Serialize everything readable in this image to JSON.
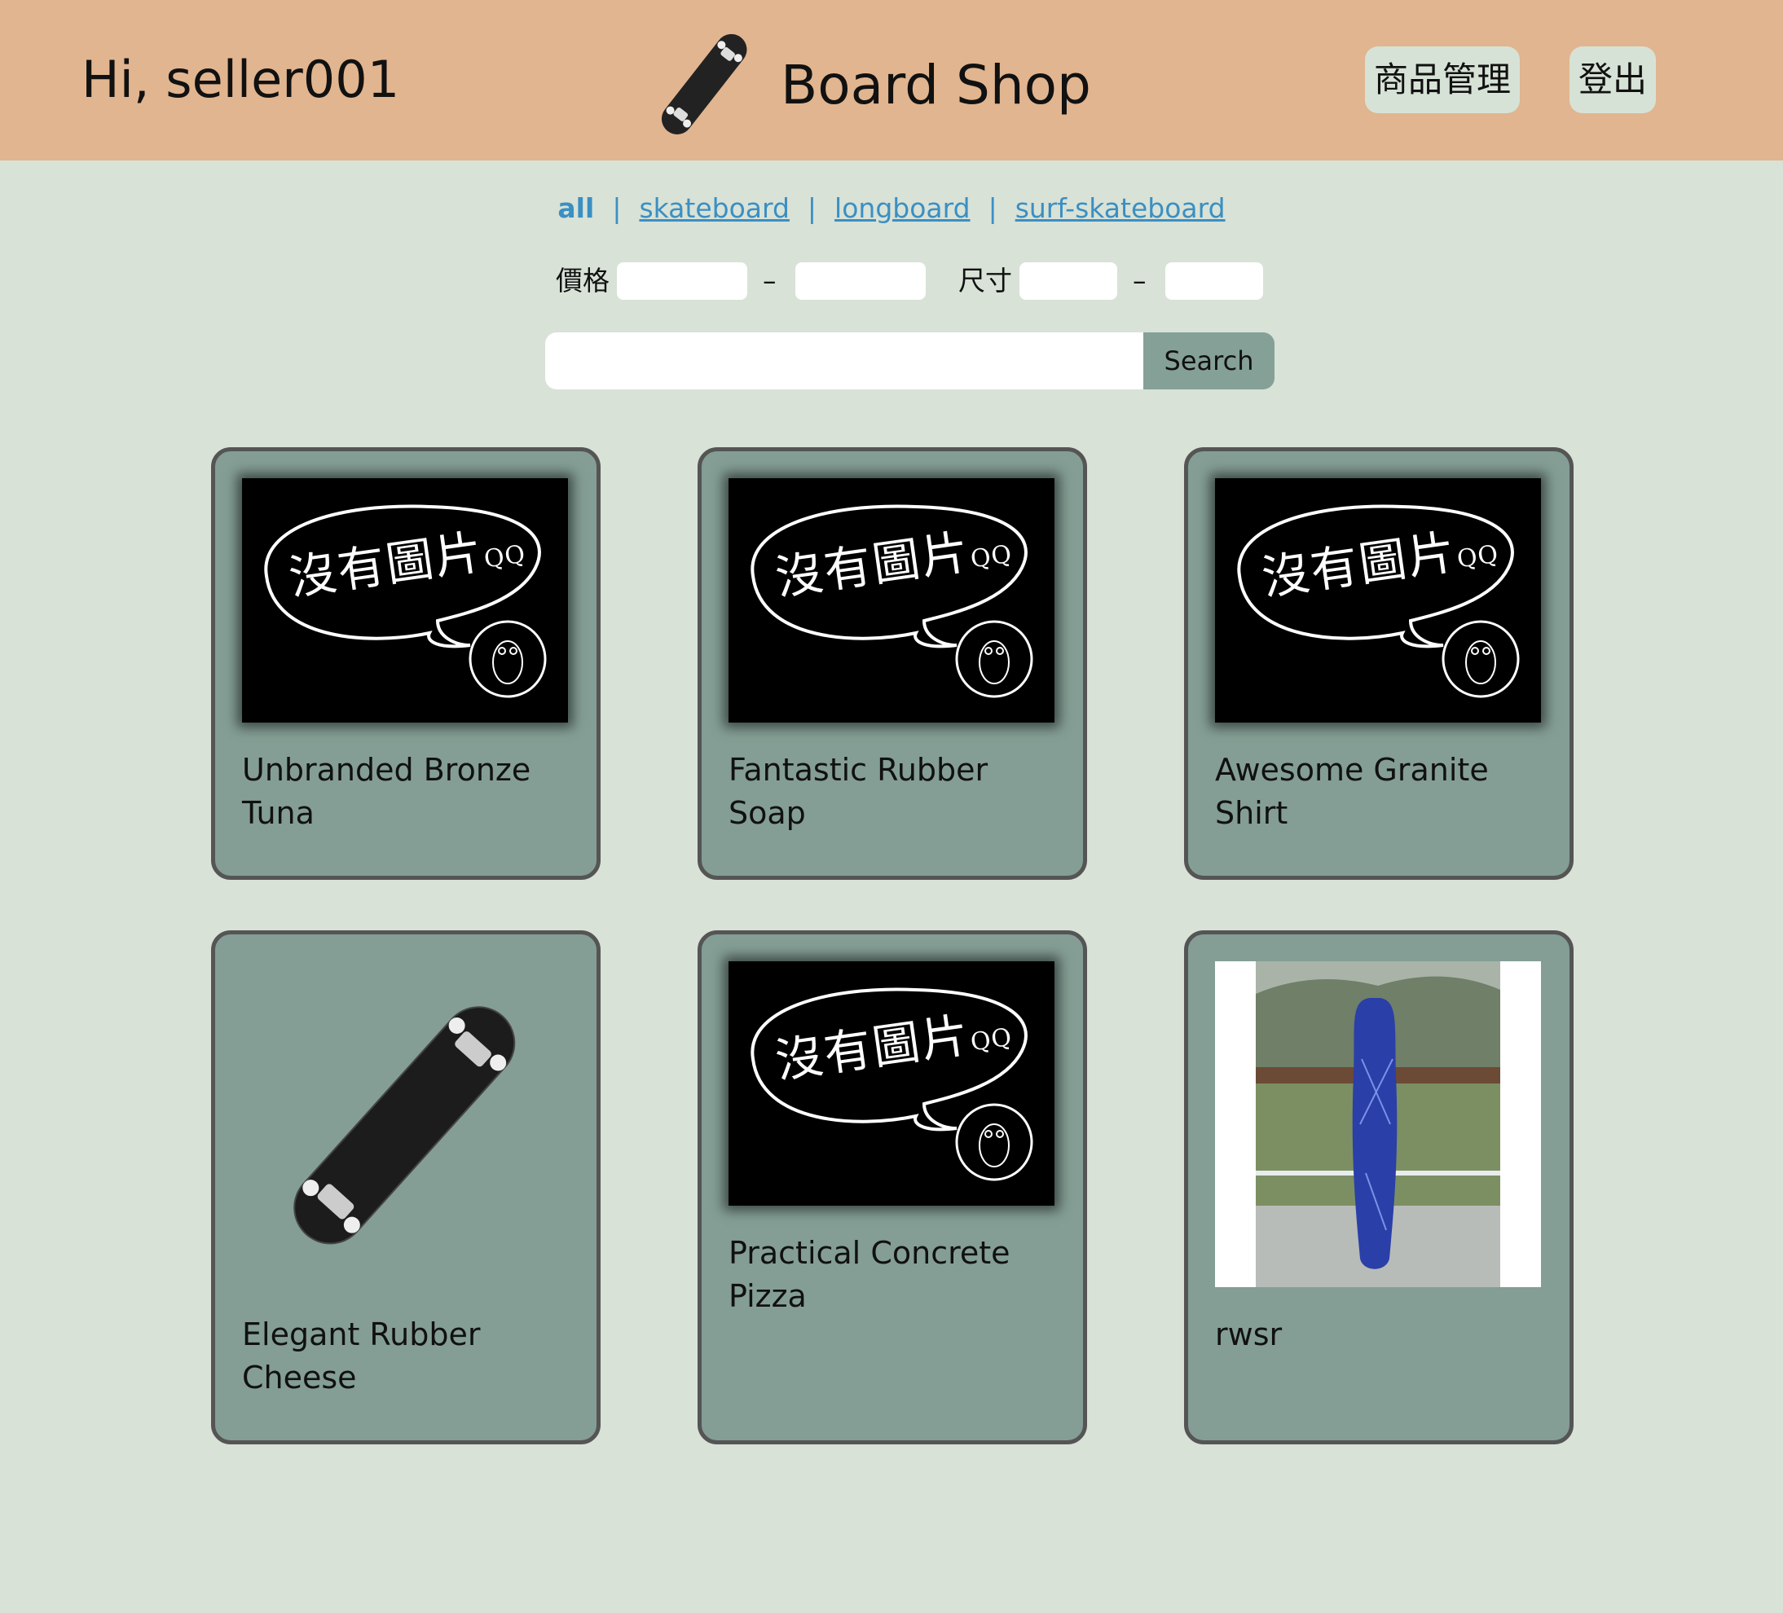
{
  "header": {
    "greeting": "Hi, seller001",
    "shop_name": "Board Shop",
    "logo_icon": "skateboard-icon",
    "manage_label": "商品管理",
    "logout_label": "登出"
  },
  "categories": {
    "items": [
      "all",
      "skateboard",
      "longboard",
      "surf-skateboard"
    ],
    "selected": "all"
  },
  "filters": {
    "price_label": "價格",
    "size_label": "尺寸",
    "range_separator": "–",
    "price_min": "",
    "price_max": "",
    "size_min": "",
    "size_max": ""
  },
  "search": {
    "value": "",
    "button_label": "Search"
  },
  "products": [
    {
      "name": "Unbranded Bronze Tuna",
      "image": "no-image-placeholder",
      "placeholder_text": "沒有圖片",
      "placeholder_suffix": "QQ"
    },
    {
      "name": "Fantastic Rubber Soap",
      "image": "no-image-placeholder",
      "placeholder_text": "沒有圖片",
      "placeholder_suffix": "QQ"
    },
    {
      "name": "Awesome Granite Shirt",
      "image": "no-image-placeholder",
      "placeholder_text": "沒有圖片",
      "placeholder_suffix": "QQ"
    },
    {
      "name": "Elegant Rubber Cheese",
      "image": "skateboard-photo"
    },
    {
      "name": "Practical Concrete Pizza",
      "image": "no-image-placeholder",
      "placeholder_text": "沒有圖片",
      "placeholder_suffix": "QQ"
    },
    {
      "name": "rwsr",
      "image": "longboard-photo"
    }
  ],
  "colors": {
    "header_bg": "#e1b58f",
    "page_bg": "#d8e2d7",
    "card_bg": "#849e95",
    "card_border": "#555555",
    "link": "#3b8fc2",
    "search_button": "#85a097"
  }
}
